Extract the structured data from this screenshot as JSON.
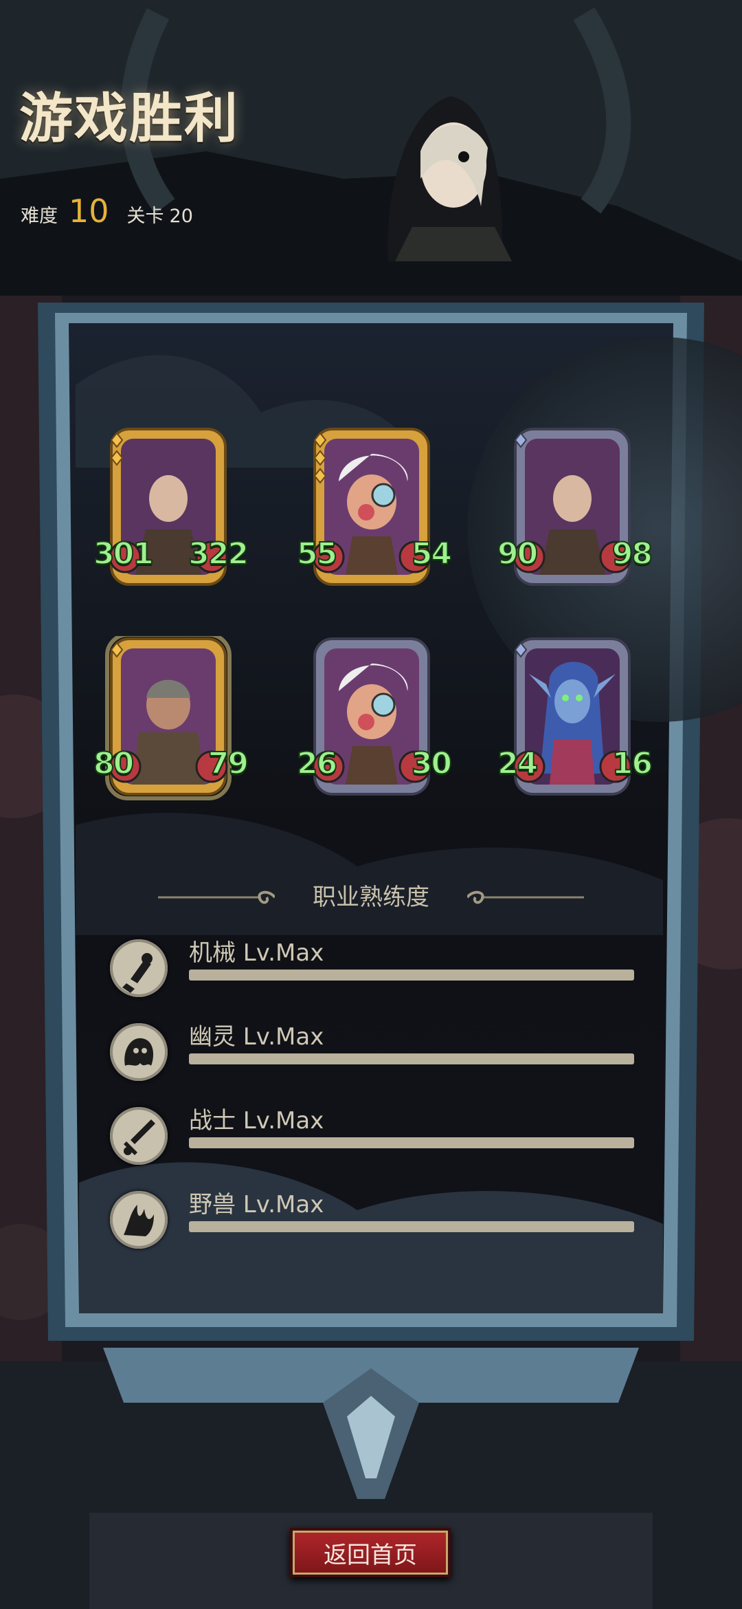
{
  "header": {
    "title": "游戏胜利",
    "difficulty_label": "难度",
    "difficulty_value": "10",
    "stage_label": "关卡",
    "stage_value": "20"
  },
  "cards": [
    {
      "character": "hooded-old-man-portrait",
      "frame": "gold",
      "gems": 2,
      "attack": "301",
      "health": "322"
    },
    {
      "character": "goggled-gnome-portrait",
      "frame": "gold",
      "gems": 3,
      "attack": "55",
      "health": "54"
    },
    {
      "character": "hooded-old-man-portrait",
      "frame": "silver",
      "gems": 1,
      "attack": "90",
      "health": "98"
    },
    {
      "character": "bald-brute-portrait",
      "frame": "gold",
      "gems": 1,
      "attack": "80",
      "health": "79"
    },
    {
      "character": "goggled-gnome-portrait",
      "frame": "silver",
      "gems": 0,
      "attack": "26",
      "health": "30"
    },
    {
      "character": "blue-elf-sorceress-portrait",
      "frame": "silver",
      "gems": 1,
      "attack": "24",
      "health": "16"
    }
  ],
  "mastery": {
    "title": "职业熟练度",
    "items": [
      {
        "icon": "gear-hand-icon",
        "label": "机械 Lv.Max",
        "progress": 1.0
      },
      {
        "icon": "ghost-icon",
        "label": "幽灵 Lv.Max",
        "progress": 1.0
      },
      {
        "icon": "sword-icon",
        "label": "战士 Lv.Max",
        "progress": 1.0
      },
      {
        "icon": "beast-claw-icon",
        "label": "野兽 Lv.Max",
        "progress": 1.0
      }
    ]
  },
  "return_button": "返回首页",
  "colors": {
    "gold_frame": "#d7a13d",
    "silver_frame": "#7c7f9b",
    "stat_text": "#9ff08f",
    "button": "#9c1f22"
  }
}
